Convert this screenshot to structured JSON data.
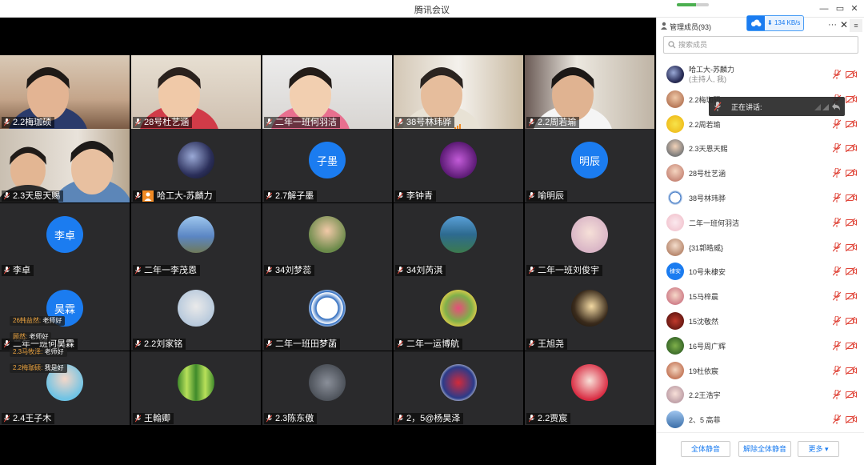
{
  "window": {
    "title": "腾讯会议",
    "progress": 0.6
  },
  "tiles": [
    {
      "name": "2.2梅珈硕"
    },
    {
      "name": "28号杜艺涵"
    },
    {
      "name": "二年一班何羽洁"
    },
    {
      "name": "38号林玮骅"
    },
    {
      "name": "2.2周若瑜"
    },
    {
      "name": "2.3天恩天赐"
    },
    {
      "name": "哈工大-苏麟力"
    },
    {
      "name": "2.7解子墨",
      "avatar_text": "子墨"
    },
    {
      "name": "李钟青"
    },
    {
      "name": "喻明辰",
      "avatar_text": "明辰"
    },
    {
      "name": "李卓",
      "avatar_text": "李卓"
    },
    {
      "name": "二年一李茂恩"
    },
    {
      "name": "34刘梦蕊"
    },
    {
      "name": "34刘芮淇"
    },
    {
      "name": "二年一班刘俊宇"
    },
    {
      "name": "二年一班何昊霖",
      "avatar_text": "昊霖"
    },
    {
      "name": "2.2刘家铭"
    },
    {
      "name": "二年一班田梦菡"
    },
    {
      "name": "二年一运博航"
    },
    {
      "name": "王旭尧"
    },
    {
      "name": "2.4王子木"
    },
    {
      "name": "王翰卿"
    },
    {
      "name": "2.3陈东傲"
    },
    {
      "name": "2，5@杨昊泽"
    },
    {
      "name": "2.2贾宸"
    }
  ],
  "chat": [
    {
      "who": "26韩益然:",
      "msg": "老师好"
    },
    {
      "who": "顾然:",
      "msg": "老师好"
    },
    {
      "who": "2.3马牧泽:",
      "msg": "老师好"
    },
    {
      "who": "2.2梅珈硕:",
      "msg": "我是好"
    }
  ],
  "panel": {
    "title": "管理成员(93)",
    "net_rate": "134 KB/s",
    "search_placeholder": "搜索成员",
    "speaking_label": "正在讲话:",
    "members": [
      {
        "name": "哈工大-苏麟力",
        "sub": "(主持人, 我)"
      },
      {
        "name": "2.2梅珈硕"
      },
      {
        "name": "2.2周若瑜"
      },
      {
        "name": "2.3天恩天赐"
      },
      {
        "name": "28号杜艺涵"
      },
      {
        "name": "38号林玮骅"
      },
      {
        "name": "二年一班何羽洁"
      },
      {
        "name": "{31郭皓威}"
      },
      {
        "name": "10号朱棣安",
        "avatar_text": "棣安"
      },
      {
        "name": "15马梓晨"
      },
      {
        "name": "15沈敬然"
      },
      {
        "name": "16号周广辉"
      },
      {
        "name": "19杜依宸"
      },
      {
        "name": "2.2王浩宇"
      },
      {
        "name": "2、5 高菲"
      }
    ],
    "buttons": {
      "mute_all": "全体静音",
      "unmute_all": "解除全体静音",
      "more": "更多 ▾"
    }
  },
  "colors": {
    "accent": "#1b7cf0",
    "mic_off": "#e0473b",
    "tile_bg": "#2a2a2c"
  }
}
